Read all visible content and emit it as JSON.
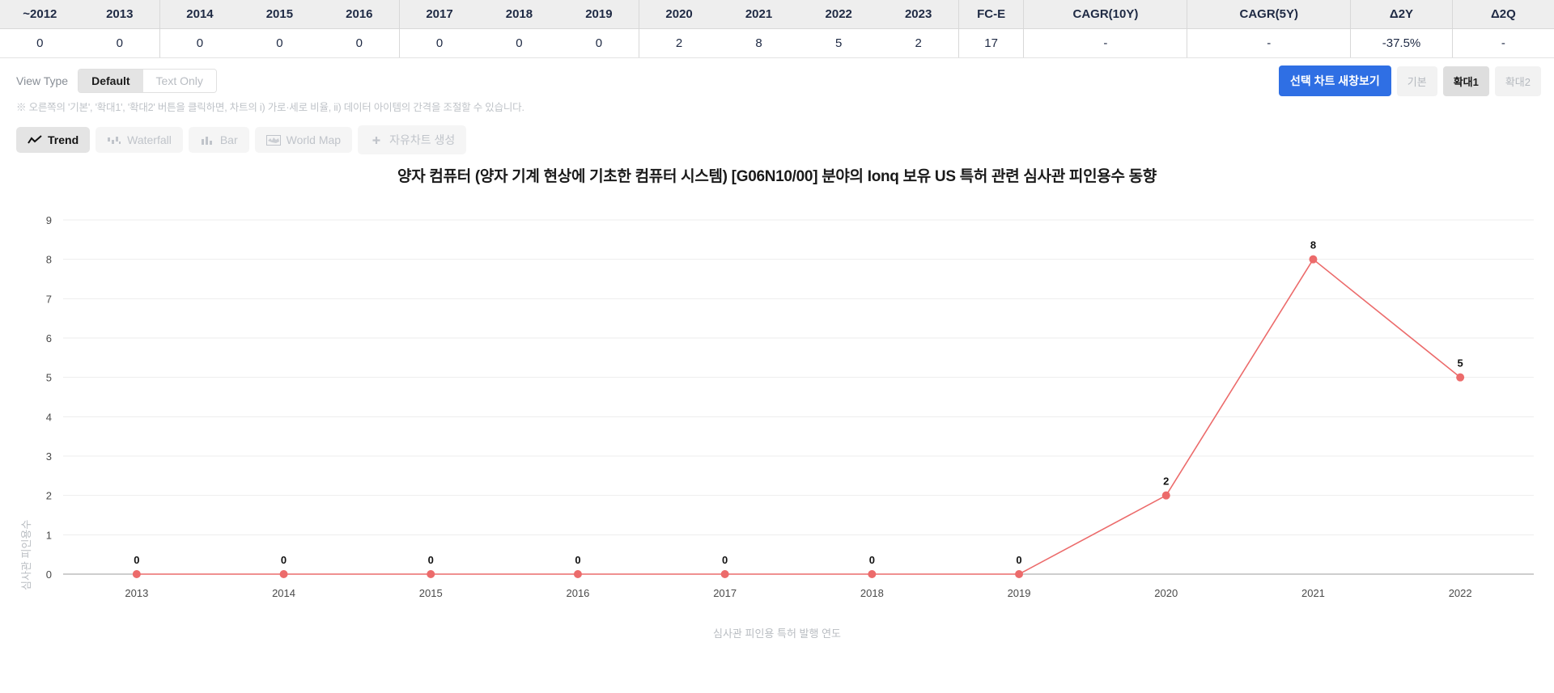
{
  "table": {
    "headers": [
      "~2012",
      "2013",
      "2014",
      "2015",
      "2016",
      "2017",
      "2018",
      "2019",
      "2020",
      "2021",
      "2022",
      "2023",
      "FC-E",
      "CAGR(10Y)",
      "CAGR(5Y)",
      "Δ2Y",
      "Δ2Q"
    ],
    "values": [
      "0",
      "0",
      "0",
      "0",
      "0",
      "0",
      "0",
      "0",
      "2",
      "8",
      "5",
      "2",
      "17",
      "-",
      "-",
      "-37.5%",
      "-"
    ]
  },
  "view_type": {
    "label": "View Type",
    "options": [
      "Default",
      "Text Only"
    ],
    "selected": "Default"
  },
  "top_right": {
    "new_window_label": "선택 차트 새창보기",
    "zoom_options": [
      "기본",
      "확대1",
      "확대2"
    ],
    "zoom_selected": "확대1"
  },
  "note": "※ 오른쪽의 '기본', '확대1', '확대2' 버튼을 클릭하면, 차트의 i) 가로·세로 비율, ii) 데이터 아이템의 간격을 조절할 수 있습니다.",
  "chart_types": [
    {
      "label": "Trend",
      "icon": "trendline-icon",
      "active": true
    },
    {
      "label": "Waterfall",
      "icon": "waterfall-icon",
      "active": false
    },
    {
      "label": "Bar",
      "icon": "bar-icon",
      "active": false
    },
    {
      "label": "World Map",
      "icon": "world-map-icon",
      "active": false
    },
    {
      "label": "자유차트 생성",
      "icon": "plus-icon",
      "active": false
    }
  ],
  "chart_data": {
    "type": "line",
    "title": "양자 컴퓨터 (양자 기계 현상에 기초한 컴퓨터 시스템) [G06N10/00] 분야의 Ionq 보유 US 특허 관련 심사관 피인용수 동향",
    "xlabel": "심사관 피인용 특허 발행 연도",
    "ylabel": "심사관 피인용수",
    "categories": [
      "2013",
      "2014",
      "2015",
      "2016",
      "2017",
      "2018",
      "2019",
      "2020",
      "2021",
      "2022"
    ],
    "values": [
      0,
      0,
      0,
      0,
      0,
      0,
      0,
      2,
      8,
      5
    ],
    "point_labels": [
      "0",
      "0",
      "0",
      "0",
      "0",
      "0",
      "0",
      "2",
      "8",
      "5"
    ],
    "yticks": [
      "0",
      "1",
      "2",
      "3",
      "4",
      "5",
      "6",
      "7",
      "8",
      "9"
    ],
    "ylim": [
      0,
      9
    ],
    "grid": true,
    "legend": false,
    "series_color": "#ec6b6b"
  }
}
